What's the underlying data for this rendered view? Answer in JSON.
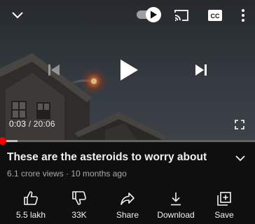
{
  "player": {
    "current_time": "0:03",
    "separator": " / ",
    "duration": "20:06",
    "progress_fraction": 0.0025,
    "buffered_fraction": 0.07,
    "autoplay_on": true,
    "icons": {
      "collapse": "chevron-down-icon",
      "autoplay": "autoplay-toggle-icon",
      "cast": "cast-icon",
      "captions": "closed-captions-icon",
      "captions_text": "CC",
      "more": "more-vert-icon",
      "previous": "skip-previous-icon",
      "play": "play-icon",
      "next": "skip-next-icon",
      "fullscreen": "fullscreen-icon"
    }
  },
  "video": {
    "title": "These are the asteroids to worry about",
    "views": "6.1 crore views",
    "meta_separator": " · ",
    "age": "10 months ago"
  },
  "actions": [
    {
      "label": "5.5 lakh",
      "icon": "thumbs-up-icon"
    },
    {
      "label": "33K",
      "icon": "thumbs-down-icon"
    },
    {
      "label": "Share",
      "icon": "share-icon"
    },
    {
      "label": "Download",
      "icon": "download-icon"
    },
    {
      "label": "Save",
      "icon": "save-to-playlist-icon"
    }
  ],
  "colors": {
    "background": "#0f0f0f",
    "progress": "#ff0000",
    "text_primary": "#f1f1f1",
    "text_secondary": "#aaaaaa"
  }
}
